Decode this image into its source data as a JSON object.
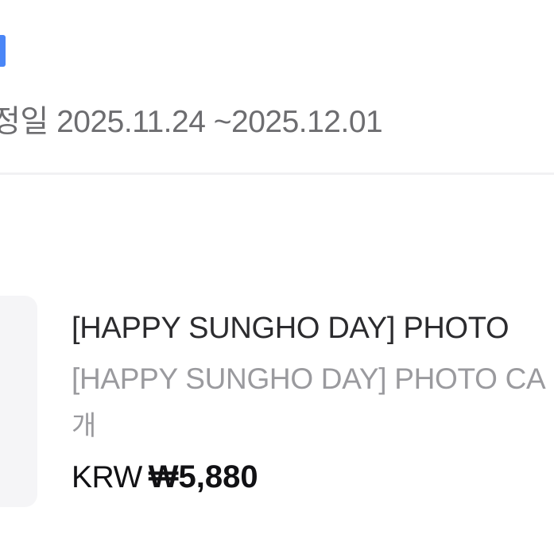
{
  "schedule": {
    "text": "정일 2025.11.24 ~2025.12.01"
  },
  "item": {
    "title": "[HAPPY SUNGHO DAY] PHOTO",
    "option": "[HAPPY SUNGHO DAY] PHOTO CA",
    "quantity": "개",
    "currency": "KRW",
    "price": "₩5,880"
  },
  "colors": {
    "accent": "#4a86f7",
    "muted": "#9a9a9e",
    "divider": "#f1f1f3"
  }
}
